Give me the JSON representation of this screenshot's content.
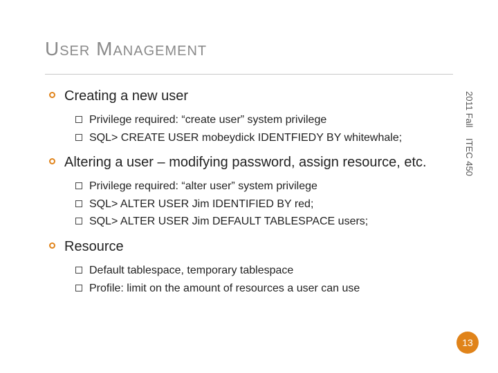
{
  "title": "User Management",
  "side": {
    "term": "2011 Fall",
    "course": "ITEC 450"
  },
  "items": [
    {
      "heading": "Creating a new user",
      "sub": [
        "Privilege required:  “create user” system privilege",
        "SQL> CREATE USER mobeydick IDENTFIEDY BY whitewhale;"
      ]
    },
    {
      "heading": "Altering a user – modifying password, assign resource, etc.",
      "sub": [
        "Privilege required: “alter user” system privilege",
        "SQL> ALTER USER Jim IDENTIFIED BY red;",
        "SQL> ALTER USER Jim DEFAULT TABLESPACE users;"
      ]
    },
    {
      "heading": "Resource",
      "sub": [
        "Default tablespace, temporary tablespace",
        "Profile: limit on the amount of resources a user can use"
      ]
    }
  ],
  "page": "13"
}
